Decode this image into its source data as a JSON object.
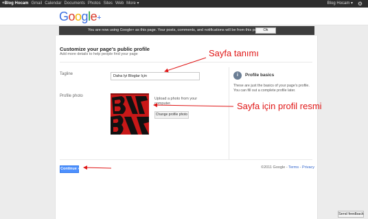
{
  "topbar": {
    "links": [
      "+Blog Hocam",
      "Gmail",
      "Calendar",
      "Documents",
      "Photos",
      "Sites",
      "Web",
      "More ▾"
    ],
    "user": "Blog Hocam ▾",
    "settings_icon": "gear-icon"
  },
  "header": {
    "logo": {
      "l1": "G",
      "l2": "o",
      "l3": "o",
      "l4": "g",
      "l5": "l",
      "l6": "e",
      "plus": "+"
    }
  },
  "notice": {
    "message": "You are now using Google+ as this page. Your posts, comments, and notifications will be from this page.",
    "ok_label": "Ok"
  },
  "profile": {
    "title": "Customize your page's public profile",
    "subtitle": "Add more details to help people find your page",
    "tagline_label": "Tagline",
    "tagline_value": "Daha İyi Bloglar İçin",
    "photo_label": "Profile photo",
    "upload_text": "Upload a photo from your computer.",
    "change_photo_label": "Change profile photo"
  },
  "basics": {
    "title": "Profile basics",
    "text": "These are just the basics of your page's profile. You can fill out a complete profile later."
  },
  "actions": {
    "continue_label": "Continue »"
  },
  "footer": {
    "copyright": "©2011 Google",
    "sep1": " - ",
    "terms": "Terms",
    "sep2": " - ",
    "privacy": "Privacy"
  },
  "feedback_label": "Send feedback",
  "annotations": {
    "tagline_note": "Sayfa tanımı",
    "photo_note": "Sayfa için profil resmi",
    "color": "#e01616"
  },
  "colors": {
    "topbar": "#2d2d2d",
    "notice": "#3d3d3d",
    "continue": "#4d90fe",
    "photo": "#c81818"
  }
}
